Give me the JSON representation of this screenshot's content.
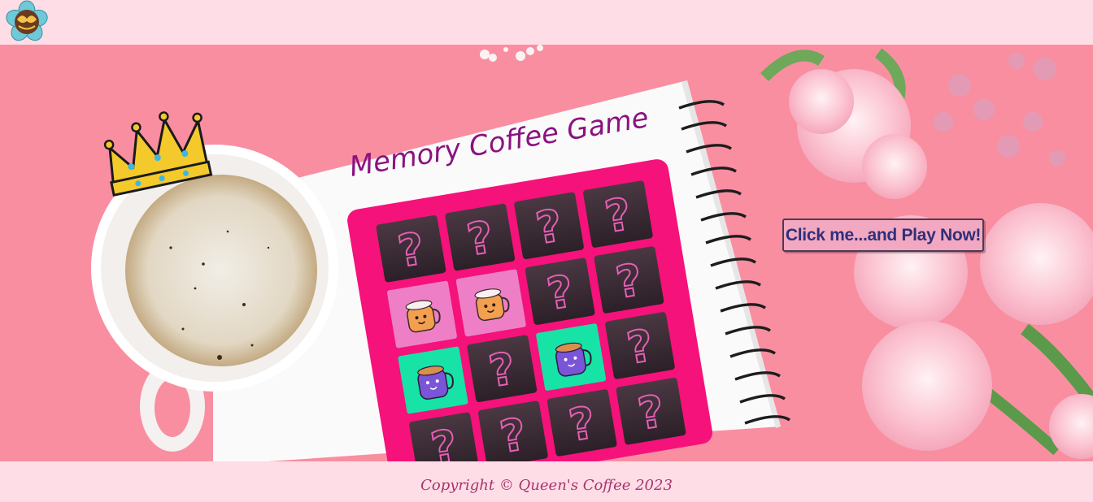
{
  "header": {
    "logo_icon": "queens-coffee-flower-logo-icon"
  },
  "hero": {
    "game_title": "Memory Coffee Game",
    "play_button_label": "Click me...and Play Now!",
    "icons": {
      "crown": "crown-icon",
      "coffee_cup": "coffee-cup-icon",
      "card_back": "question-mark-card-icon",
      "orange_cup": "orange-coffee-mug-card-icon",
      "purple_cup": "purple-coffee-mug-card-icon"
    },
    "colors": {
      "background": "#f98ea1",
      "board": "#f5127a",
      "title": "#8a1380",
      "card_back": "#3a2a34",
      "card_face_pink": "#ee7fc6",
      "card_face_green": "#17e3a6"
    }
  },
  "footer": {
    "copyright": "Copyright © Queen's Coffee 2023"
  }
}
